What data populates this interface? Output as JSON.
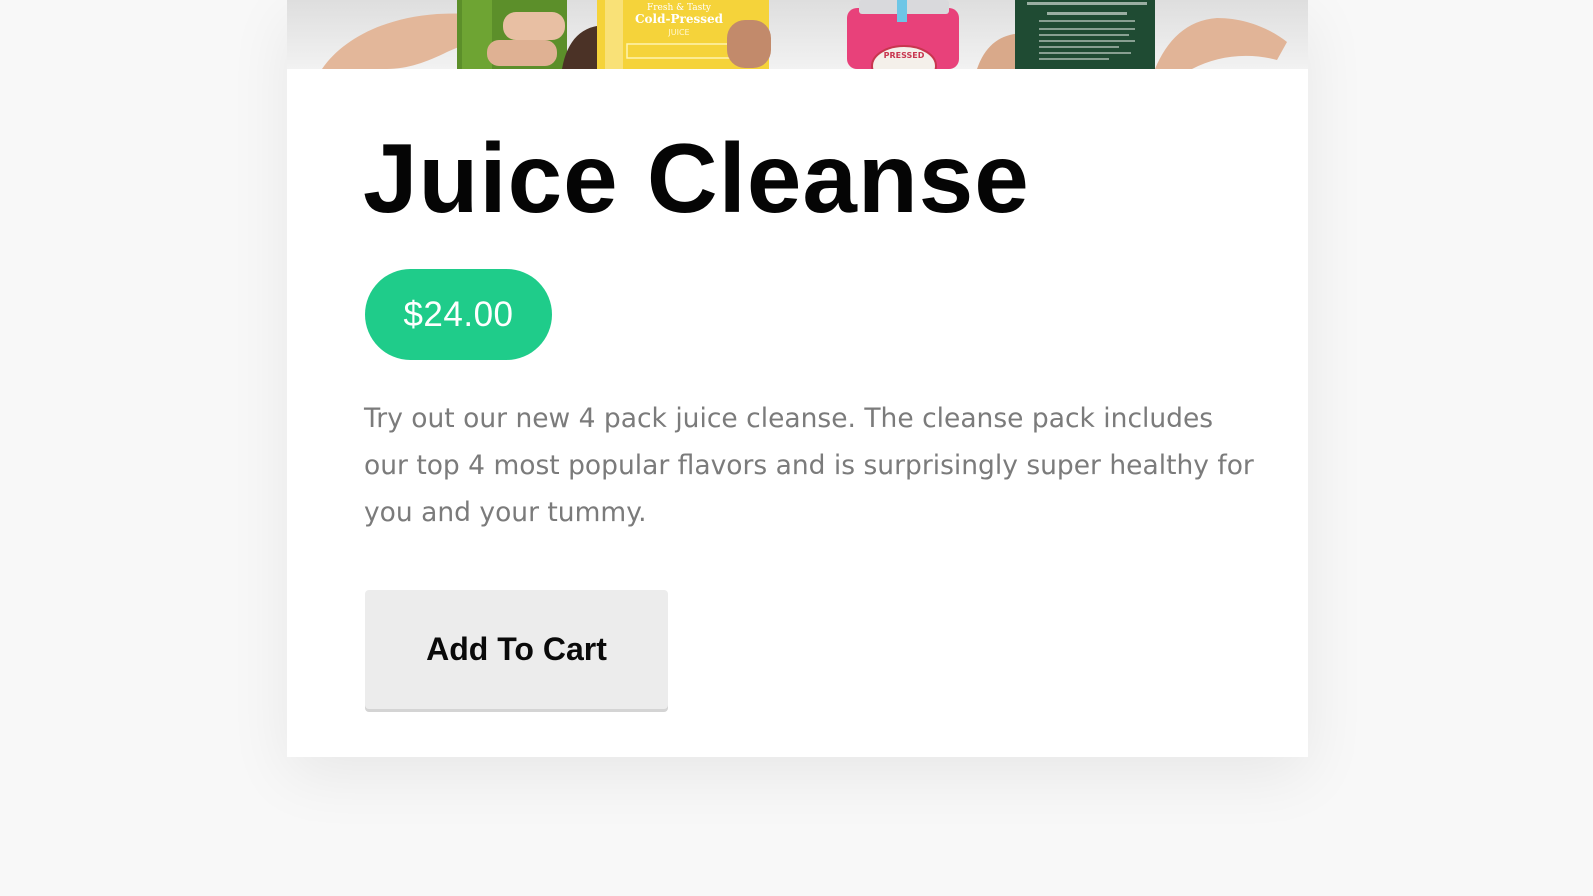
{
  "product": {
    "title": "Juice Cleanse",
    "price": "$24.00",
    "description": "Try out our new 4 pack juice cleanse. The cleanse pack includes our top 4 most popular flavors and is surprisingly super healthy for you and your tummy.",
    "cta_label": "Add To Cart",
    "image": {
      "bottle_label_line1": "Fresh & Tasty",
      "bottle_label_line2": "Cold-Pressed",
      "bottle_label_line3": "JUICE",
      "jar_label": "PRESSED"
    }
  },
  "colors": {
    "price_badge": "#1fcc8a",
    "button_bg": "#ececec",
    "title_text": "#050505",
    "description_text": "#7b7b7b"
  }
}
